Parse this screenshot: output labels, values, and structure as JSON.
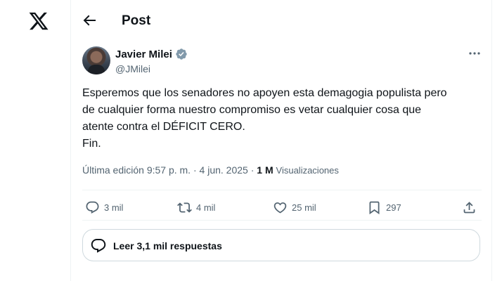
{
  "app": {
    "logo_icon": "x-logo-icon"
  },
  "header": {
    "back_icon": "arrow-left-icon",
    "title": "Post"
  },
  "post": {
    "author": {
      "name": "Javier Milei",
      "handle": "@JMilei",
      "verified_icon": "verified-badge-icon",
      "verified_color": "#829aab"
    },
    "text": "Esperemos que los senadores no apoyen esta demagogia populista pero\nde cualquier forma nuestro compromiso es vetar cualquier cosa que\natente contra el DÉFICIT CERO.\nFin.",
    "meta": {
      "edited_label": "Última edición 9:57 p. m.",
      "separator": " · ",
      "date": "4 jun. 2025",
      "views_count": "1 M",
      "views_label": "Visualizaciones"
    },
    "actions": {
      "reply": {
        "icon": "reply-icon",
        "count": "3 mil"
      },
      "repost": {
        "icon": "repost-icon",
        "count": "4 mil"
      },
      "like": {
        "icon": "heart-icon",
        "count": "25 mil"
      },
      "bookmark": {
        "icon": "bookmark-icon",
        "count": "297"
      },
      "share": {
        "icon": "share-icon"
      }
    },
    "replies_button": {
      "icon": "replies-bubble-icon",
      "label": "Leer 3,1 mil respuestas"
    }
  },
  "colors": {
    "text": "#0f1419",
    "secondary": "#536471",
    "border": "#eff3f4",
    "button_border": "#cfd9de"
  }
}
